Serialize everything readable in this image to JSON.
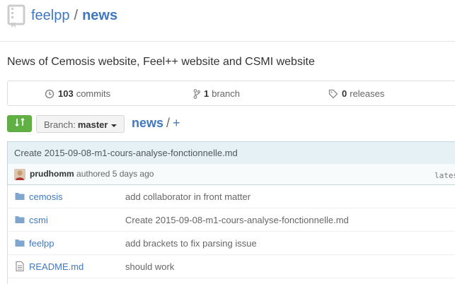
{
  "header": {
    "owner": "feelpp",
    "separator": "/",
    "repo": "news"
  },
  "description": "News of Cemosis website, Feel++ website and CSMI website",
  "summary": {
    "commits_count": "103",
    "commits_label": "commits",
    "branch_count": "1",
    "branch_label": "branch",
    "releases_count": "0",
    "releases_label": "releases"
  },
  "branch_selector": {
    "label": "Branch:",
    "value": "master"
  },
  "path": {
    "root": "news",
    "separator": "/",
    "add": "+"
  },
  "latest_commit": {
    "message": "Create 2015-09-08-m1-cours-analyse-fonctionnelle.md",
    "author": "prudhomm",
    "authored_text": "authored 5 days ago",
    "latest_label": "lates"
  },
  "files": [
    {
      "type": "folder",
      "name": "cemosis",
      "message": "add collaborator in front matter"
    },
    {
      "type": "folder",
      "name": "csmi",
      "message": "Create 2015-09-08-m1-cours-analyse-fonctionnelle.md"
    },
    {
      "type": "folder",
      "name": "feelpp",
      "message": "add brackets to fix parsing issue"
    },
    {
      "type": "file",
      "name": "README.md",
      "message": "should work"
    }
  ],
  "colors": {
    "link": "#4078c0",
    "compare_green": "#60b044",
    "commit_bar": "#e6f1f6"
  }
}
